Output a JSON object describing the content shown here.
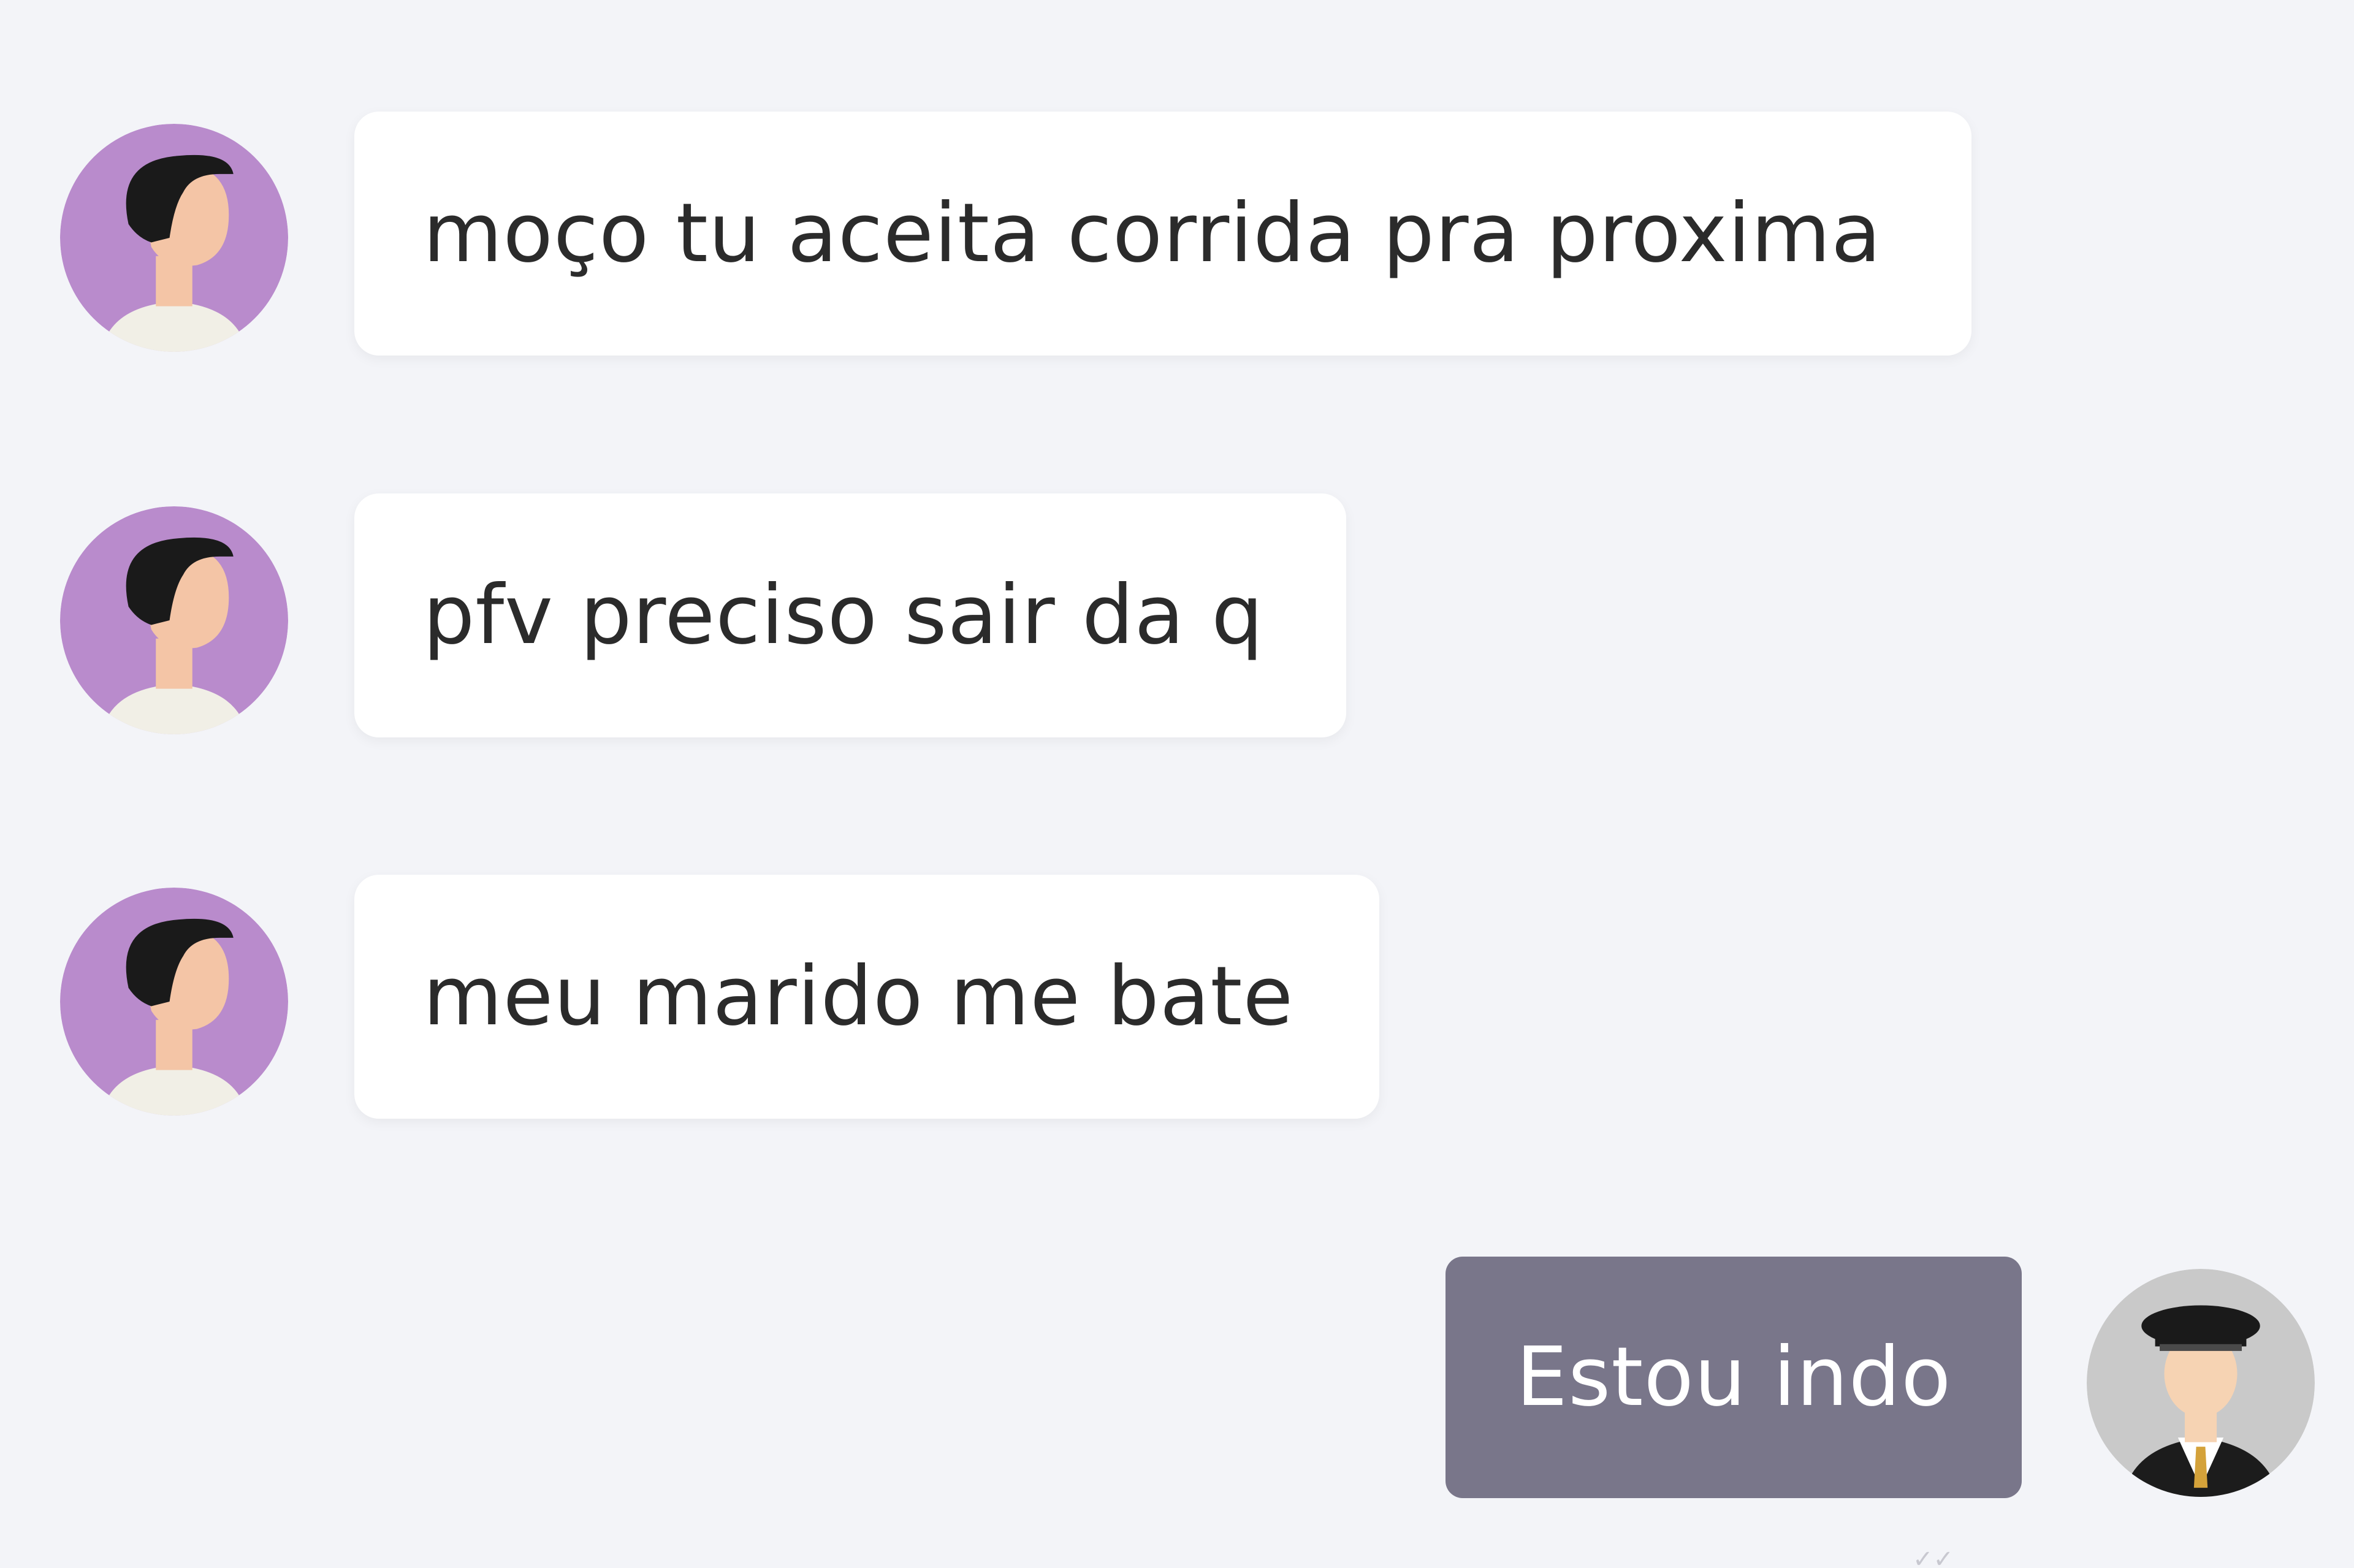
{
  "messages": [
    {
      "sender": "passenger",
      "text": "moço tu aceita corrida pra proxima"
    },
    {
      "sender": "passenger",
      "text": "pfv preciso sair da q"
    },
    {
      "sender": "passenger",
      "text": "meu marido me bate"
    },
    {
      "sender": "driver",
      "text": "Estou indo"
    }
  ],
  "avatars": {
    "passenger": {
      "icon": "passenger-avatar-icon",
      "background": "#b98bcc"
    },
    "driver": {
      "icon": "driver-avatar-icon",
      "background": "#c9c9c9"
    }
  },
  "colors": {
    "background": "#f3f4f8",
    "incoming_bubble": "#ffffff",
    "outgoing_bubble": "#79768a"
  }
}
